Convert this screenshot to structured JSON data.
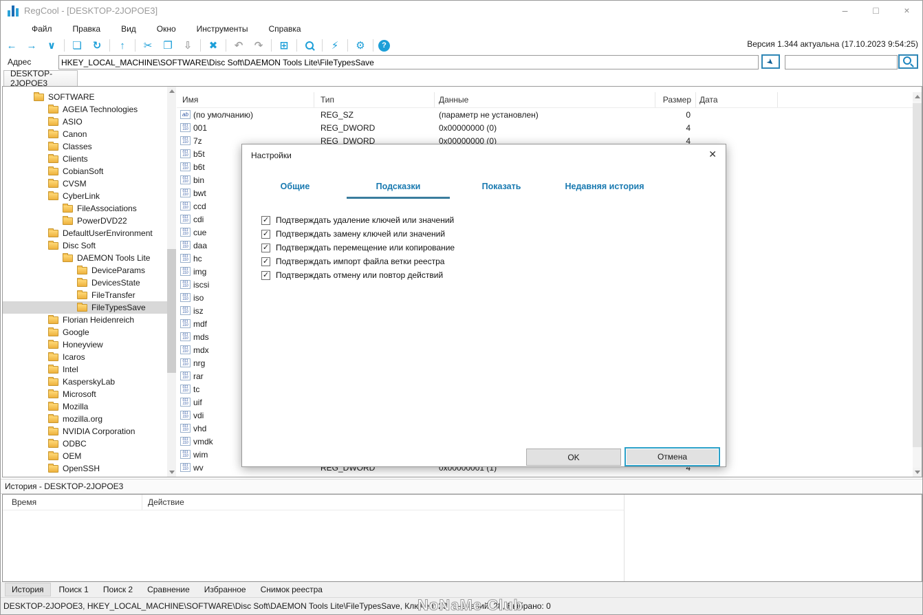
{
  "window": {
    "title": "RegCool - [DESKTOP-2JOPOE3]",
    "controls": {
      "minimize": "–",
      "maximize": "□",
      "close": "×"
    }
  },
  "menu": {
    "items": [
      {
        "name": "menu-file",
        "label": "Файл"
      },
      {
        "name": "menu-edit",
        "label": "Правка"
      },
      {
        "name": "menu-view",
        "label": "Вид"
      },
      {
        "name": "menu-window",
        "label": "Окно"
      },
      {
        "name": "menu-tools",
        "label": "Инструменты"
      },
      {
        "name": "menu-help",
        "label": "Справка"
      }
    ]
  },
  "toolbar": {
    "version_text": "Версия 1.344 актуальна (17.10.2023 9:54:25)",
    "buttons": [
      {
        "name": "back-icon",
        "glyph": "←"
      },
      {
        "name": "forward-icon",
        "glyph": "→"
      },
      {
        "name": "history-dropdown-icon",
        "glyph": "∨"
      },
      {
        "name": "separator",
        "sep": true
      },
      {
        "name": "connect-computer-icon",
        "glyph": "❏"
      },
      {
        "name": "refresh-icon",
        "glyph": "↻"
      },
      {
        "name": "separator",
        "sep": true
      },
      {
        "name": "parent-key-icon",
        "glyph": "↑"
      },
      {
        "name": "separator",
        "sep": true
      },
      {
        "name": "cut-icon",
        "glyph": "✂"
      },
      {
        "name": "copy-icon",
        "glyph": "❐"
      },
      {
        "name": "paste-icon",
        "glyph": "⇩",
        "disabled": true
      },
      {
        "name": "separator",
        "sep": true
      },
      {
        "name": "delete-icon",
        "glyph": "✖"
      },
      {
        "name": "separator",
        "sep": true
      },
      {
        "name": "undo-icon",
        "glyph": "↶",
        "disabled": true
      },
      {
        "name": "redo-icon",
        "glyph": "↷",
        "disabled": true
      },
      {
        "name": "separator",
        "sep": true
      },
      {
        "name": "new-key-icon",
        "glyph": "⊞"
      },
      {
        "name": "separator",
        "sep": true
      },
      {
        "name": "search-icon",
        "glyph": "",
        "mag": true
      },
      {
        "name": "separator",
        "sep": true
      },
      {
        "name": "compare-icon",
        "glyph": "⚡"
      },
      {
        "name": "separator",
        "sep": true
      },
      {
        "name": "settings-icon",
        "glyph": "⚙"
      },
      {
        "name": "separator",
        "sep": true
      },
      {
        "name": "help-icon",
        "glyph": "?",
        "circle": true
      }
    ]
  },
  "address_bar": {
    "label": "Адрес",
    "value": "HKEY_LOCAL_MACHINE\\SOFTWARE\\Disc Soft\\DAEMON Tools Lite\\FileTypesSave",
    "go_glyph": "➤",
    "filter_value": ""
  },
  "session_tab": {
    "label": "DESKTOP-2JOPOE3"
  },
  "tree": {
    "items": [
      {
        "name": "key-software",
        "label": "SOFTWARE",
        "level": 0
      },
      {
        "name": "key-ageia-technologies",
        "label": "AGEIA Technologies",
        "level": 1
      },
      {
        "name": "key-asio",
        "label": "ASIO",
        "level": 1
      },
      {
        "name": "key-canon",
        "label": "Canon",
        "level": 1
      },
      {
        "name": "key-classes",
        "label": "Classes",
        "level": 1
      },
      {
        "name": "key-clients",
        "label": "Clients",
        "level": 1
      },
      {
        "name": "key-cobiansoft",
        "label": "CobianSoft",
        "level": 1
      },
      {
        "name": "key-cvsm",
        "label": "CVSM",
        "level": 1
      },
      {
        "name": "key-cyberlink",
        "label": "CyberLink",
        "level": 1
      },
      {
        "name": "key-fileassociations",
        "label": "FileAssociations",
        "level": 2
      },
      {
        "name": "key-powerdvd22",
        "label": "PowerDVD22",
        "level": 2
      },
      {
        "name": "key-defaultuserenvironment",
        "label": "DefaultUserEnvironment",
        "level": 1
      },
      {
        "name": "key-disc-soft",
        "label": "Disc Soft",
        "level": 1
      },
      {
        "name": "key-daemon-tools-lite",
        "label": "DAEMON Tools Lite",
        "level": 2
      },
      {
        "name": "key-deviceparams",
        "label": "DeviceParams",
        "level": 3
      },
      {
        "name": "key-devicesstate",
        "label": "DevicesState",
        "level": 3
      },
      {
        "name": "key-filetransfer",
        "label": "FileTransfer",
        "level": 3
      },
      {
        "name": "key-filetypessave",
        "label": "FileTypesSave",
        "level": 3,
        "selected": true
      },
      {
        "name": "key-florian-heidenreich",
        "label": "Florian Heidenreich",
        "level": 1
      },
      {
        "name": "key-google",
        "label": "Google",
        "level": 1
      },
      {
        "name": "key-honeyview",
        "label": "Honeyview",
        "level": 1
      },
      {
        "name": "key-icaros",
        "label": "Icaros",
        "level": 1
      },
      {
        "name": "key-intel",
        "label": "Intel",
        "level": 1
      },
      {
        "name": "key-kasperskylab",
        "label": "KasperskyLab",
        "level": 1
      },
      {
        "name": "key-microsoft",
        "label": "Microsoft",
        "level": 1
      },
      {
        "name": "key-mozilla",
        "label": "Mozilla",
        "level": 1
      },
      {
        "name": "key-mozilla-org",
        "label": "mozilla.org",
        "level": 1
      },
      {
        "name": "key-nvidia-corporation",
        "label": "NVIDIA Corporation",
        "level": 1
      },
      {
        "name": "key-odbc",
        "label": "ODBC",
        "level": 1
      },
      {
        "name": "key-oem",
        "label": "OEM",
        "level": 1
      },
      {
        "name": "key-openssh",
        "label": "OpenSSH",
        "level": 1
      }
    ]
  },
  "list": {
    "columns": [
      {
        "label": "Имя"
      },
      {
        "label": "Тип"
      },
      {
        "label": "Данные"
      },
      {
        "label": "Размер"
      },
      {
        "label": "Дата"
      }
    ],
    "rows": [
      {
        "name": "(по умолчанию)",
        "sz": true,
        "icon_text": "ab",
        "type": "REG_SZ",
        "data": "(параметр не установлен)",
        "size": "0"
      },
      {
        "name": "001",
        "dword": true,
        "icon_text": "011 110",
        "type": "REG_DWORD",
        "data": "0x00000000 (0)",
        "size": "4"
      },
      {
        "name": "7z",
        "dword": true,
        "icon_text": "011 110",
        "type": "REG_DWORD",
        "data": "0x00000000 (0)",
        "size": "4"
      },
      {
        "name": "b5t",
        "dword": true,
        "icon_text": "011 110",
        "type": "",
        "data": "",
        "size": ""
      },
      {
        "name": "b6t",
        "dword": true,
        "icon_text": "011 110",
        "type": "",
        "data": "",
        "size": ""
      },
      {
        "name": "bin",
        "dword": true,
        "icon_text": "011 110",
        "type": "",
        "data": "",
        "size": ""
      },
      {
        "name": "bwt",
        "dword": true,
        "icon_text": "011 110",
        "type": "",
        "data": "",
        "size": ""
      },
      {
        "name": "ccd",
        "dword": true,
        "icon_text": "011 110",
        "type": "",
        "data": "",
        "size": ""
      },
      {
        "name": "cdi",
        "dword": true,
        "icon_text": "011 110",
        "type": "",
        "data": "",
        "size": ""
      },
      {
        "name": "cue",
        "dword": true,
        "icon_text": "011 110",
        "type": "",
        "data": "",
        "size": ""
      },
      {
        "name": "daa",
        "dword": true,
        "icon_text": "011 110",
        "type": "",
        "data": "",
        "size": ""
      },
      {
        "name": "hc",
        "dword": true,
        "icon_text": "011 110",
        "type": "",
        "data": "",
        "size": ""
      },
      {
        "name": "img",
        "dword": true,
        "icon_text": "011 110",
        "type": "",
        "data": "",
        "size": ""
      },
      {
        "name": "iscsi",
        "dword": true,
        "icon_text": "011 110",
        "type": "",
        "data": "",
        "size": ""
      },
      {
        "name": "iso",
        "dword": true,
        "icon_text": "011 110",
        "type": "",
        "data": "",
        "size": ""
      },
      {
        "name": "isz",
        "dword": true,
        "icon_text": "011 110",
        "type": "",
        "data": "",
        "size": ""
      },
      {
        "name": "mdf",
        "dword": true,
        "icon_text": "011 110",
        "type": "",
        "data": "",
        "size": ""
      },
      {
        "name": "mds",
        "dword": true,
        "icon_text": "011 110",
        "type": "",
        "data": "",
        "size": ""
      },
      {
        "name": "mdx",
        "dword": true,
        "icon_text": "011 110",
        "type": "",
        "data": "",
        "size": ""
      },
      {
        "name": "nrg",
        "dword": true,
        "icon_text": "011 110",
        "type": "",
        "data": "",
        "size": ""
      },
      {
        "name": "rar",
        "dword": true,
        "icon_text": "011 110",
        "type": "",
        "data": "",
        "size": ""
      },
      {
        "name": "tc",
        "dword": true,
        "icon_text": "011 110",
        "type": "",
        "data": "",
        "size": ""
      },
      {
        "name": "uif",
        "dword": true,
        "icon_text": "011 110",
        "type": "",
        "data": "",
        "size": ""
      },
      {
        "name": "vdi",
        "dword": true,
        "icon_text": "011 110",
        "type": "",
        "data": "",
        "size": ""
      },
      {
        "name": "vhd",
        "dword": true,
        "icon_text": "011 110",
        "type": "",
        "data": "",
        "size": ""
      },
      {
        "name": "vmdk",
        "dword": true,
        "icon_text": "011 110",
        "type": "",
        "data": "",
        "size": ""
      },
      {
        "name": "wim",
        "dword": true,
        "icon_text": "011 110",
        "type": "",
        "data": "",
        "size": ""
      },
      {
        "name": "wv",
        "dword": true,
        "icon_text": "011 110",
        "type": "REG_DWORD",
        "data": "0x00000001 (1)",
        "size": "4"
      }
    ]
  },
  "dialog": {
    "title": "Настройки",
    "close_glyph": "✕",
    "check_glyph": "✓",
    "tabs": [
      {
        "name": "tab-general",
        "label": "Общие"
      },
      {
        "name": "tab-hints",
        "label": "Подсказки",
        "active": true
      },
      {
        "name": "tab-show",
        "label": "Показать"
      },
      {
        "name": "tab-recent-history",
        "label": "Недавняя история"
      }
    ],
    "options": [
      {
        "label": "Подтверждать удаление ключей или значений",
        "checked": true
      },
      {
        "label": "Подтверждать замену ключей или значений",
        "checked": true
      },
      {
        "label": "Подтверждать перемещение или копирование",
        "checked": true
      },
      {
        "label": "Подтверждать импорт файла ветки реестра",
        "checked": true
      },
      {
        "label": "Подтверждать отмену или повтор действий",
        "checked": true
      }
    ],
    "ok_label": "OK",
    "cancel_label": "Отмена"
  },
  "history": {
    "title": "История - DESKTOP-2JOPOE3",
    "columns": [
      {
        "label": "Время"
      },
      {
        "label": "Действие"
      }
    ]
  },
  "bottom_tabs": {
    "items": [
      {
        "name": "tab-history",
        "label": "История",
        "active": true
      },
      {
        "name": "tab-search-1",
        "label": "Поиск 1"
      },
      {
        "name": "tab-search-2",
        "label": "Поиск 2"
      },
      {
        "name": "tab-compare",
        "label": "Сравнение"
      },
      {
        "name": "tab-favorites",
        "label": "Избранное"
      },
      {
        "name": "tab-registry-snapshot",
        "label": "Снимок реестра"
      }
    ]
  },
  "status_bar": {
    "text": "DESKTOP-2JOPOE3, HKEY_LOCAL_MACHINE\\SOFTWARE\\Disc Soft\\DAEMON Tools Lite\\FileTypesSave, Ключей: 23, Значений: 28, Выбрано: 0",
    "watermark": "NoNaMe Club"
  },
  "colors": {
    "toolbar_icon": "#1d9fd8",
    "dialog_tab_text": "#1879b0",
    "active_tab_underline": "#3a7d9e",
    "focus_button_border": "#2aa0c8",
    "folder_icon": "#f2bc4a",
    "selected_tree_bg": "#d8d8d8"
  }
}
